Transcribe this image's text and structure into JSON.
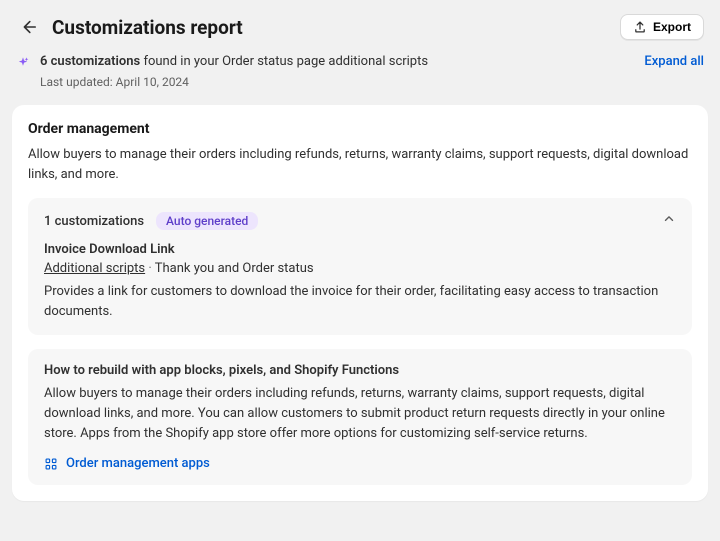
{
  "header": {
    "title": "Customizations report",
    "export_label": "Export"
  },
  "summary": {
    "count_text": "6 customizations",
    "found_text": " found in your Order status page additional scripts",
    "last_updated": "Last updated: April 10, 2024",
    "expand_all": "Expand all"
  },
  "section": {
    "title": "Order management",
    "description": "Allow buyers to manage their orders including refunds, returns, warranty claims, support requests, digital download links, and more."
  },
  "customizations_panel": {
    "count_label": "1 customizations",
    "badge": "Auto generated",
    "item": {
      "title": "Invoice Download Link",
      "source": "Additional scripts",
      "context": "Thank you and Order status",
      "description": "Provides a link for customers to download the invoice for their order, facilitating easy access to transaction documents."
    }
  },
  "howto": {
    "title": "How to rebuild with app blocks, pixels, and Shopify Functions",
    "description": "Allow buyers to manage their orders including refunds, returns, warranty claims, support requests, digital download links, and more. You can allow customers to submit product return requests directly in your online store. Apps from the Shopify app store offer more options for customizing self-service returns.",
    "link_label": "Order management apps"
  }
}
